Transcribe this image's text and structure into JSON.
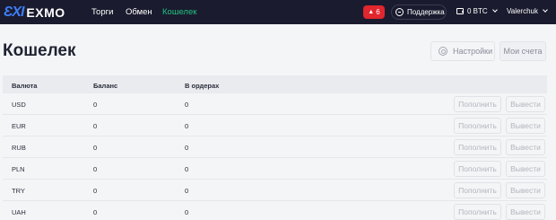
{
  "header": {
    "logo_mark": "ƐXI",
    "logo_text": "EXMO",
    "nav": [
      {
        "label": "Торги",
        "active": false
      },
      {
        "label": "Обмен",
        "active": false
      },
      {
        "label": "Кошелек",
        "active": true
      }
    ],
    "notifications_count": "6",
    "support_label": "Поддержка",
    "balance_label": "0 BTC",
    "username": "Valerchuk"
  },
  "page": {
    "title": "Кошелек",
    "settings_label": "Настройки",
    "accounts_label": "Мои счета"
  },
  "table": {
    "columns": [
      "Валюта",
      "Баланс",
      "В ордерах"
    ],
    "deposit_label": "Пополнить",
    "withdraw_label": "Вывести",
    "rows": [
      {
        "currency": "USD",
        "balance": "0",
        "in_orders": "0"
      },
      {
        "currency": "EUR",
        "balance": "0",
        "in_orders": "0"
      },
      {
        "currency": "RUB",
        "balance": "0",
        "in_orders": "0"
      },
      {
        "currency": "PLN",
        "balance": "0",
        "in_orders": "0"
      },
      {
        "currency": "TRY",
        "balance": "0",
        "in_orders": "0"
      },
      {
        "currency": "UAH",
        "balance": "0",
        "in_orders": "0"
      }
    ]
  },
  "colors": {
    "topbar": "#1a1b2e",
    "accent_green": "#22c482",
    "logo_blue": "#3d7df5",
    "notification_red": "#e0262e"
  }
}
